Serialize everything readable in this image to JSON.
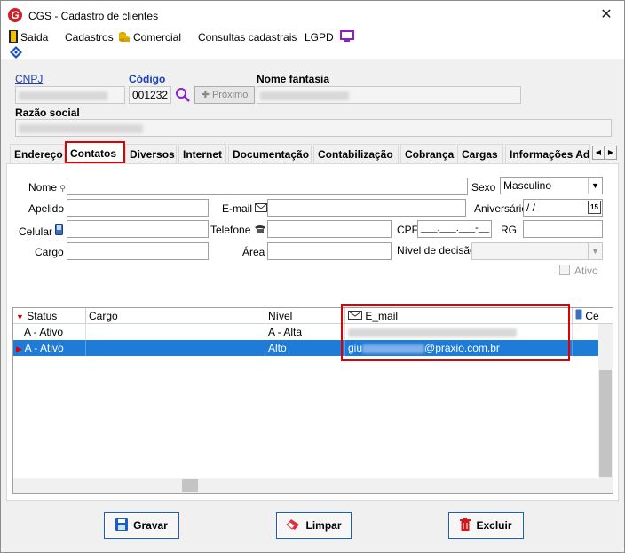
{
  "window": {
    "title": "CGS - Cadastro de clientes",
    "close_glyph": "✕"
  },
  "menu": {
    "items": [
      "Saída",
      "Cadastros",
      "Comercial",
      "Consultas cadastrais",
      "LGPD"
    ]
  },
  "header": {
    "cnpj_label": "CNPJ",
    "codigo_label": "Código",
    "codigo_value": "001232",
    "proximo_label": "Próximo",
    "nome_fantasia_label": "Nome fantasia",
    "razao_social_label": "Razão social"
  },
  "tabs": [
    "Endereço",
    "Contatos",
    "Diversos",
    "Internet",
    "Documentação",
    "Contabilização",
    "Cobrança",
    "Cargas",
    "Informações Adi"
  ],
  "form": {
    "nome_label": "Nome",
    "sexo_label": "Sexo",
    "sexo_value": "Masculino",
    "apelido_label": "Apelido",
    "email_label": "E-mail",
    "aniversario_label": "Aniversário",
    "aniversario_value": "/  /",
    "aniversario_badge": "15",
    "celular_label": "Celular",
    "telefone_label": "Telefone",
    "cpf_label": "CPF",
    "cpf_value": "___.___.___-__",
    "rg_label": "RG",
    "cargo_label": "Cargo",
    "area_label": "Área",
    "nivel_label": "Nível de decisão",
    "ativo_label": "Ativo"
  },
  "grid": {
    "columns": [
      "Status",
      "Cargo",
      "Nível",
      "E_mail",
      "Ce"
    ],
    "rows": [
      {
        "status": "A - Ativo",
        "cargo": "",
        "nivel": "A - Alta",
        "email_suffix": ""
      },
      {
        "status": "A - Ativo",
        "cargo": "",
        "nivel": "Alto",
        "email_prefix": "giu",
        "email_suffix": "@praxio.com.br"
      }
    ]
  },
  "footer": {
    "gravar": "Gravar",
    "limpar": "Limpar",
    "excluir": "Excluir"
  },
  "colors": {
    "highlight": "#e00000",
    "selection": "#1e7bd8",
    "link": "#1a3fb5"
  }
}
